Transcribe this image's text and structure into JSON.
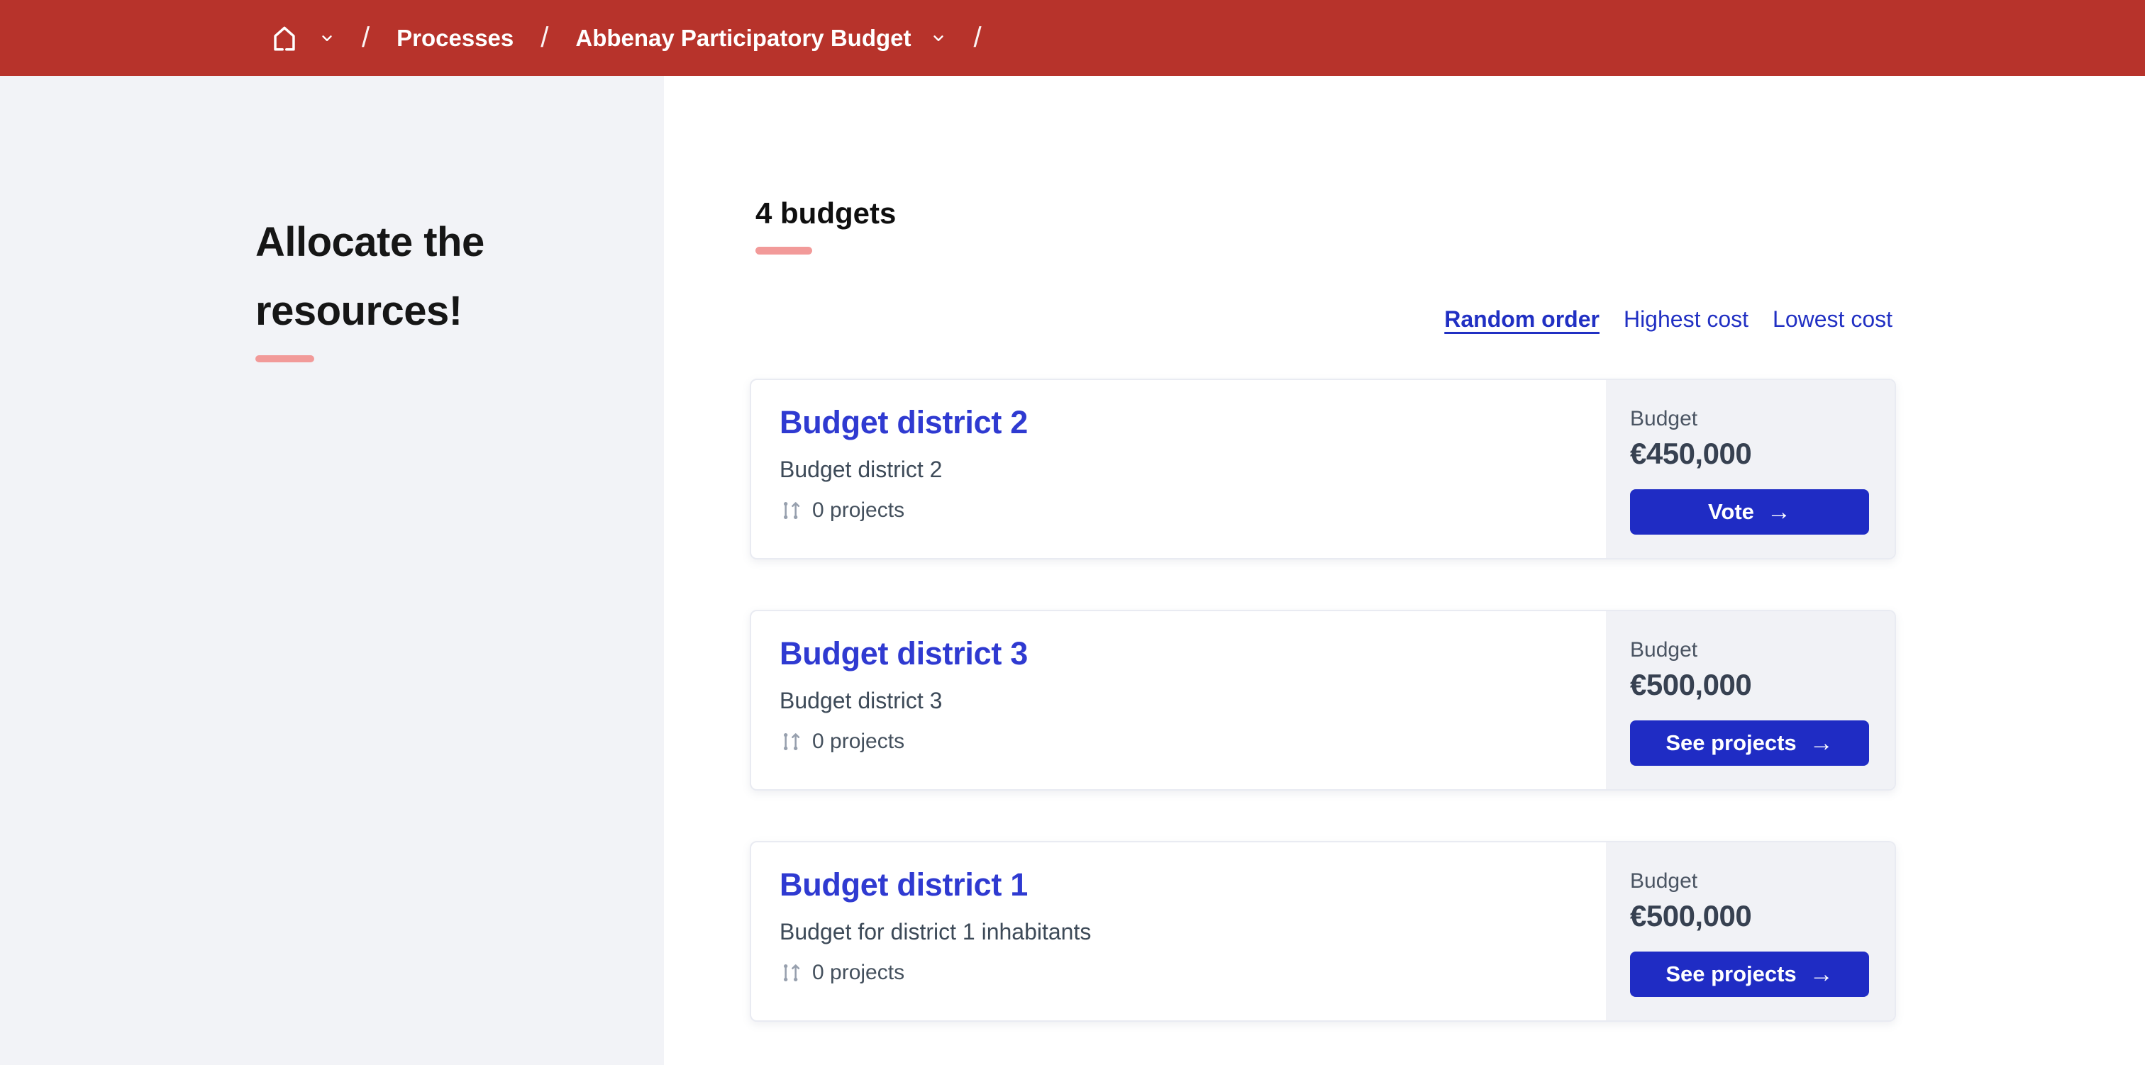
{
  "colors": {
    "header_red": "#b7332b",
    "sidebar_gray": "#f2f3f7",
    "salmon_accent": "#f29a99",
    "link_blue": "#2130c3",
    "button_blue": "#1f2cc4",
    "card_title_blue": "#2f3ad1"
  },
  "breadcrumb": {
    "separator": "/",
    "home_icon": "home-icon",
    "chevron_icon": "chevron-down-icon",
    "items": [
      "Processes",
      "Abbenay Participatory Budget"
    ]
  },
  "sidebar": {
    "title": "Allocate the resources!"
  },
  "main": {
    "heading": "4 budgets",
    "sort_options": [
      {
        "label": "Random order",
        "active": true
      },
      {
        "label": "Highest cost",
        "active": false
      },
      {
        "label": "Lowest cost",
        "active": false
      }
    ],
    "budgets": [
      {
        "title": "Budget district 2",
        "description": "Budget district 2",
        "projects_count": "0 projects",
        "budget_label": "Budget",
        "amount": "€450,000",
        "action": "Vote"
      },
      {
        "title": "Budget district 3",
        "description": "Budget district 3",
        "projects_count": "0 projects",
        "budget_label": "Budget",
        "amount": "€500,000",
        "action": "See projects"
      },
      {
        "title": "Budget district 1",
        "description": "Budget for district 1 inhabitants",
        "projects_count": "0 projects",
        "budget_label": "Budget",
        "amount": "€500,000",
        "action": "See projects"
      }
    ]
  },
  "icons": {
    "projects_icon": "git-compare-icon",
    "arrow_right": "→"
  }
}
